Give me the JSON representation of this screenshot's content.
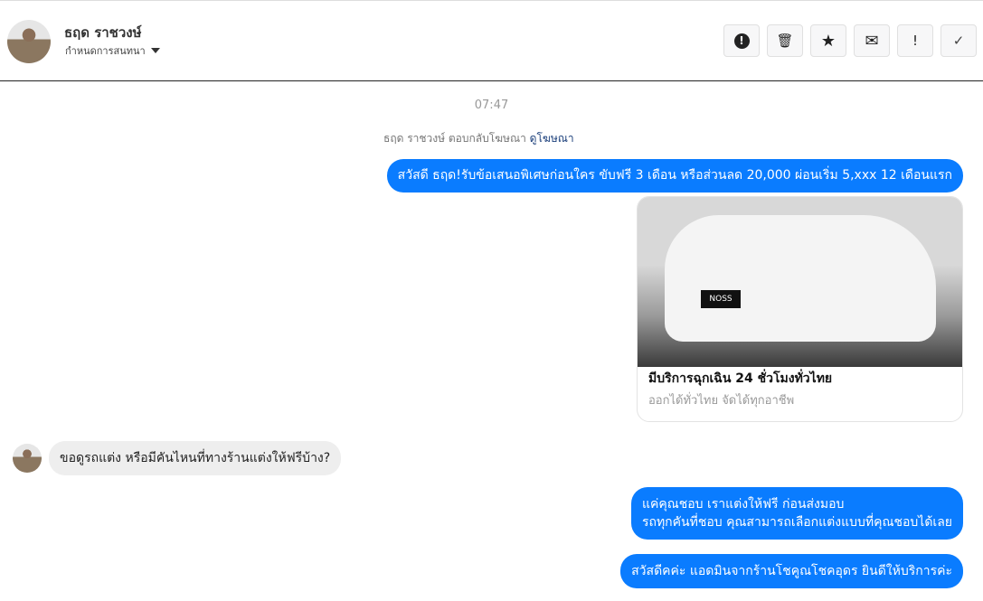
{
  "header": {
    "name": "ธฤด ราชวงษ์",
    "subtitle": "กำหนดการสนทนา",
    "actions": [
      {
        "name": "report",
        "glyph": "!"
      },
      {
        "name": "delete",
        "glyph": "🗑"
      },
      {
        "name": "star",
        "glyph": "★"
      },
      {
        "name": "mark-unread",
        "glyph": "✉"
      },
      {
        "name": "important",
        "glyph": "!"
      },
      {
        "name": "done",
        "glyph": "✓"
      }
    ]
  },
  "conversation": {
    "timestamp": "07:47",
    "ad_reply": "ธฤด ราชวงษ์ ตอบกลับโฆษณา",
    "ad_link": "ดูโฆษณา",
    "messages": [
      {
        "text": "สวัสดี ธฤด!รับข้อเสนอพิเศษก่อนใคร ขับฟรี 3 เดือน หรือส่วนลด 20,000 ผ่อนเริ่ม 5,xxx 12 เดือนแรก"
      },
      {
        "card_title": "มีบริการฉุกเฉิน 24 ชั่วโมงทั่วไทย",
        "card_subtitle": "ออกได้ทั่วไทย จัดได้ทุกอาชีพ",
        "plate": "NOSS"
      },
      {
        "text": "ขอดูรถแต่ง หรือมีคันไหนที่ทางร้านแต่งให้ฟรีบ้าง?"
      },
      {
        "line1": "แค่คุณชอบ เราแต่งให้ฟรี ก่อนส่งมอบ",
        "line2": "รถทุกคันที่ชอบ คุณสามารถเลือกแต่งแบบที่คุณชอบได้เลย"
      },
      {
        "text": "สวัสดีคค่ะ แอดมินจากร้านโชคูณโชคอุดร ยินดีให้บริการค่ะ"
      }
    ]
  }
}
